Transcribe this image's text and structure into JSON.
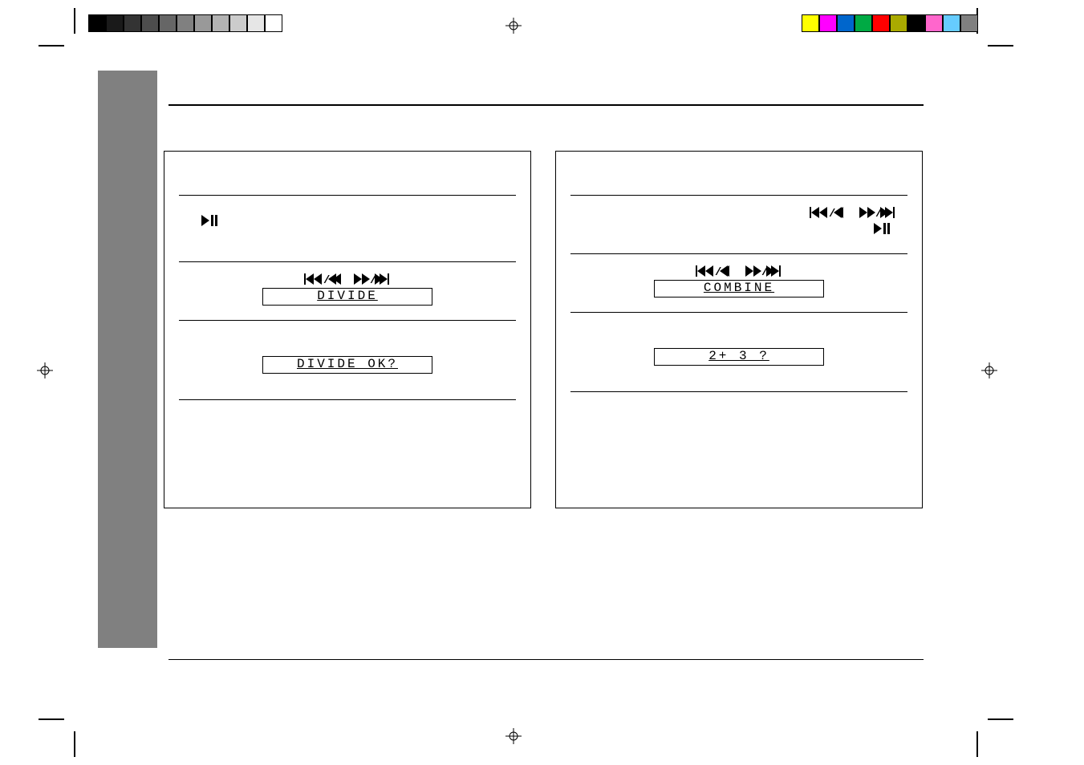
{
  "left_box": {
    "display1": "DIVIDE",
    "display2": "DIVIDE OK?"
  },
  "right_box": {
    "display1": "COMBINE",
    "display2": "2+  3 ?"
  },
  "swatches_left": [
    "#000000",
    "#1a1a1a",
    "#333333",
    "#4d4d4d",
    "#666666",
    "#808080",
    "#999999",
    "#b3b3b3",
    "#cccccc",
    "#e6e6e6",
    "#ffffff"
  ],
  "swatches_right": [
    "#ffff00",
    "#ff00ff",
    "#0066cc",
    "#00aa44",
    "#ff0000",
    "#aaaa00",
    "#000000",
    "#ff66cc",
    "#66ccff",
    "#808080"
  ]
}
